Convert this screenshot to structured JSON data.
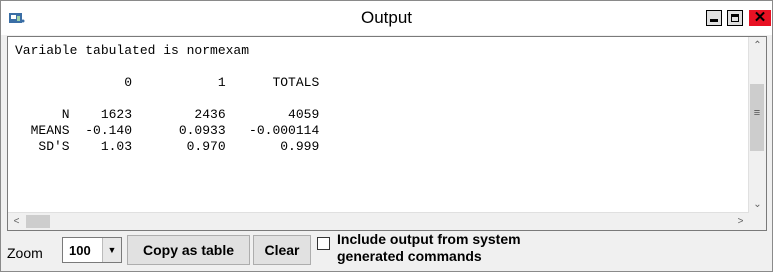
{
  "window": {
    "title": "Output"
  },
  "output": {
    "lines": [
      "Variable tabulated is normexam",
      "",
      "              0           1      TOTALS",
      "",
      "      N    1623        2436        4059",
      "  MEANS  -0.140      0.0933   -0.000114",
      "   SD'S    1.03       0.970       0.999"
    ]
  },
  "toolbar": {
    "zoom_label": "Zoom",
    "zoom_value": "100",
    "copy_label": "Copy as table",
    "clear_label": "Clear",
    "include_label": "Include output from system\ngenerated commands",
    "include_checked": false
  }
}
